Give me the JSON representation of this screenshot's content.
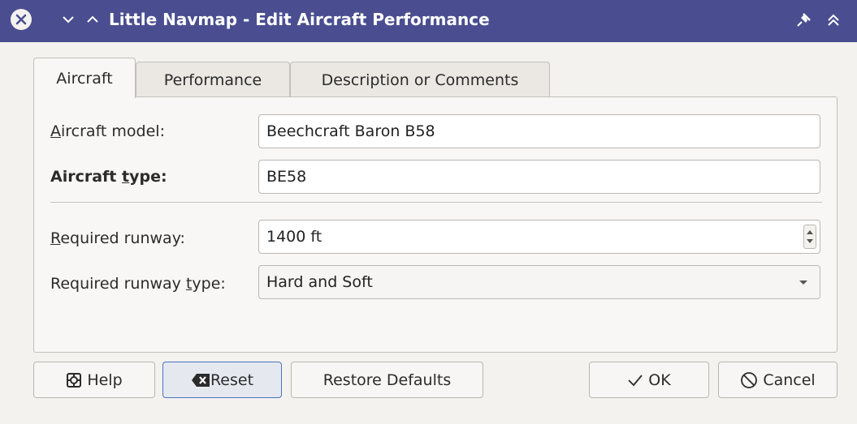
{
  "window": {
    "title": "Little Navmap - Edit Aircraft Performance",
    "titlebar_color": "#4a4e91"
  },
  "tabs": [
    {
      "label": "Aircraft",
      "active": true
    },
    {
      "label": "Performance",
      "active": false
    },
    {
      "label": "Description or Comments",
      "active": false
    }
  ],
  "form": {
    "aircraft_model": {
      "label_first": "A",
      "label_rest": "ircraft model:",
      "value": "Beechcraft Baron B58"
    },
    "aircraft_type": {
      "label_pre": "Aircraft ",
      "label_ul": "t",
      "label_post": "ype:",
      "value": "BE58"
    },
    "required_runway": {
      "label_first": "R",
      "label_rest": "equired runway:",
      "value": "1400 ft"
    },
    "required_runway_type": {
      "label_pre": "Required runway ",
      "label_ul": "t",
      "label_post": "ype:",
      "value": "Hard and Soft"
    }
  },
  "buttons": {
    "help": "Help",
    "reset": "Reset",
    "restore_defaults": "Restore Defaults",
    "ok": "OK",
    "cancel": "Cancel"
  },
  "icons": {
    "close": "close-circle-icon",
    "minimize": "chevron-down-icon",
    "maximize": "chevron-up-icon",
    "pin": "pin-icon",
    "shade": "double-chevron-up-icon",
    "help": "lifebuoy-icon",
    "reset": "backspace-icon",
    "ok": "checkmark-icon",
    "cancel": "cancel-circle-icon"
  }
}
